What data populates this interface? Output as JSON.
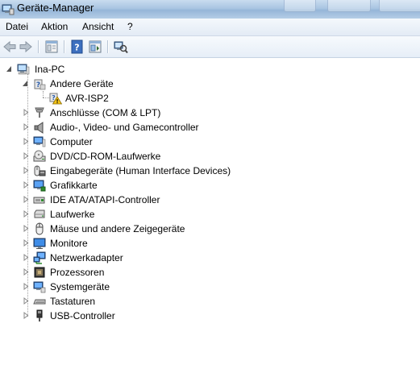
{
  "window": {
    "title": "Geräte-Manager",
    "title_icon": "device-manager-icon"
  },
  "menu": {
    "items": [
      {
        "label": "Datei"
      },
      {
        "label": "Aktion"
      },
      {
        "label": "Ansicht"
      },
      {
        "label": "?"
      }
    ]
  },
  "toolbar": {
    "buttons": [
      {
        "icon": "back-arrow-icon"
      },
      {
        "icon": "forward-arrow-icon"
      },
      {
        "icon": "properties-icon"
      },
      {
        "icon": "help-icon"
      },
      {
        "icon": "view-icon"
      },
      {
        "icon": "scan-hardware-icon"
      }
    ]
  },
  "tree": {
    "root": {
      "label": "Ina-PC",
      "icon": "computer-icon",
      "expanded": true
    },
    "other_devices": {
      "label": "Andere Geräte",
      "icon": "unknown-device-icon",
      "expanded": true
    },
    "other_child": {
      "label": "AVR-ISP2",
      "icon": "warning-device-icon"
    },
    "categories": [
      {
        "label": "Anschlüsse (COM & LPT)",
        "icon": "port-icon"
      },
      {
        "label": "Audio-, Video- und Gamecontroller",
        "icon": "speaker-icon"
      },
      {
        "label": "Computer",
        "icon": "computer-icon"
      },
      {
        "label": "DVD/CD-ROM-Laufwerke",
        "icon": "dvd-drive-icon"
      },
      {
        "label": "Eingabegeräte (Human Interface Devices)",
        "icon": "hid-icon"
      },
      {
        "label": "Grafikkarte",
        "icon": "display-adapter-icon"
      },
      {
        "label": "IDE ATA/ATAPI-Controller",
        "icon": "ide-controller-icon"
      },
      {
        "label": "Laufwerke",
        "icon": "disk-drive-icon"
      },
      {
        "label": "Mäuse und andere Zeigegeräte",
        "icon": "mouse-icon"
      },
      {
        "label": "Monitore",
        "icon": "monitor-icon"
      },
      {
        "label": "Netzwerkadapter",
        "icon": "network-adapter-icon"
      },
      {
        "label": "Prozessoren",
        "icon": "processor-icon"
      },
      {
        "label": "Systemgeräte",
        "icon": "system-device-icon"
      },
      {
        "label": "Tastaturen",
        "icon": "keyboard-icon"
      },
      {
        "label": "USB-Controller",
        "icon": "usb-icon"
      }
    ]
  }
}
